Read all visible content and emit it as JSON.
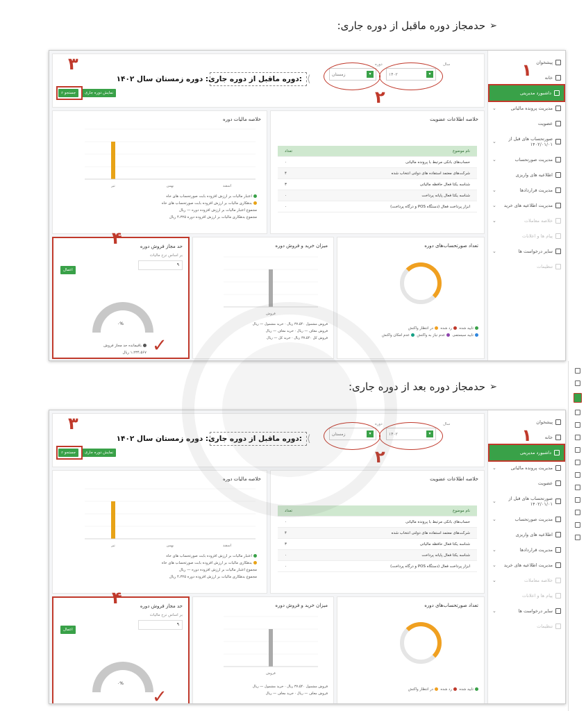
{
  "headings": {
    "prev_period": "حدمجاز دوره ماقبل از دوره جاری:",
    "next_period": "حدمجاز دوره بعد از دوره جاری:"
  },
  "sidebar": {
    "items": [
      {
        "label": "پیشخوان",
        "icon": "dashboard-icon"
      },
      {
        "label": "خانه",
        "icon": "home-icon"
      },
      {
        "label": "داشبورد مدیریتی",
        "icon": "chart-icon",
        "active": true
      },
      {
        "label": "مدیریت پرونده مالیاتی",
        "icon": "file-icon"
      },
      {
        "label": "عضویت",
        "icon": "user-icon"
      },
      {
        "label": "صورتحساب های قبل از ۱۴۰۲/۰۱/۰۱",
        "icon": "invoice-icon"
      },
      {
        "label": "مدیریت صورتحساب",
        "icon": "invoice-icon"
      },
      {
        "label": "اطلاعیه های واریزی",
        "icon": "notice-icon"
      },
      {
        "label": "مدیریت قراردادها",
        "icon": "contract-icon"
      },
      {
        "label": "مدیریت اطلاعیه های خرید",
        "icon": "cart-icon"
      },
      {
        "label": "خلاصه معاملات",
        "icon": "summary-icon",
        "dim": true
      },
      {
        "label": "پیام ها و اعلانات",
        "icon": "mail-icon",
        "dim": true
      },
      {
        "label": "سایر درخواست ها",
        "icon": "request-icon"
      },
      {
        "label": "تنظیمات",
        "icon": "gear-icon",
        "dim": true
      }
    ]
  },
  "filter": {
    "year_label": "سال",
    "year_value": "۱۴۰۲",
    "period_label": "دوره",
    "period_value": "زمستان",
    "callout": ":دوره ماقبل از دوره جاری: دوره زمستان سال ۱۴۰۲",
    "show_current_btn": "نمایش دوره جاری",
    "search_btn": "جستجو"
  },
  "marks": {
    "n1": "۱",
    "n2": "۲",
    "n3": "۳",
    "n4": "۴"
  },
  "membership": {
    "title": "خلاصه اطلاعات عضویت",
    "col_subject": "نام موضوع",
    "col_count": "تعداد",
    "rows": [
      {
        "subject": "حساب‌های بانکی مرتبط با پرونده مالیاتی",
        "count": "۰"
      },
      {
        "subject": "شرکت‌های معتمد استفاده های دولتی انتخاب شده",
        "count": "۴"
      },
      {
        "subject": "شناسه یکتا فعال حافظه مالیاتی",
        "count": "۳"
      },
      {
        "subject": "شناسه یکتا فعال پایانه پرداخت",
        "count": "۰"
      },
      {
        "subject": "ابزار پرداخت فعال (دستگاه POS و درگاه پرداخت)",
        "count": "۰"
      }
    ]
  },
  "tax_summary": {
    "title": "خلاصه مالیات دوره",
    "ylabel": "(میلیون ریال)",
    "legend": [
      "اعتبار مالیات بر ارزش افزوده بابت صورتحساب های خاه",
      "بدهکاری مالیات بر ارزش افزوده بابت صورتحساب های خاه",
      "مجموع اعتبار مالیات بر ارزش افزوده دوره — ریال",
      "مجموع بدهکاری مالیات بر ارزش افزوده دوره ۴،۳۲۵ ریال"
    ]
  },
  "chart_data": [
    {
      "type": "bar",
      "categories": [
        "تیر",
        "بهمن",
        "اسفند"
      ],
      "values": [
        1.2,
        0,
        0
      ],
      "ylim": [
        0,
        1.6
      ],
      "colors": [
        "#e8a317"
      ]
    },
    {
      "type": "bar",
      "categories": [
        "فروش"
      ],
      "values": [
        1.2
      ],
      "ylim": [
        0,
        1.6
      ],
      "colors": [
        "#aaaaaa"
      ]
    }
  ],
  "sales_limit": {
    "title": "حد مجاز فروش دوره",
    "subtitle": "بر اساس نرخ مالیات",
    "input_value": "۹",
    "apply_btn": "اعمال",
    "gauge_value": "۰%",
    "legend_name": "باقیمانده حد مجاز فروش",
    "legend_value": "۱،۲۳۴،۵۶۷ ریال"
  },
  "trade": {
    "title": "میزان خرید و فروش دوره",
    "ylabel": "(میلیون ریال)",
    "xlabel": "فروش",
    "legend": [
      "فروش مشمول ۳۷،۵۴۰ ریال",
      "خرید مشمول — ریال",
      "فروش معاف — ریال",
      "خرید معاف — ریال",
      "فروش کل ۳۷،۵۴۰ ریال",
      "خرید کل — ریال"
    ]
  },
  "invoice_count": {
    "title": "تعداد صورتحساب‌های دوره",
    "donut_label": "تعداد صورتحساب فروش",
    "donut_value": "۲۵",
    "legend": [
      "تایید شده",
      "رد شده",
      "در انتظار واکنش",
      "تایید سیستمی",
      "عدم نیاز به واکنش",
      "عدم امکان واکنش"
    ]
  },
  "colors": {
    "brand_green": "#39a148",
    "annotation_red": "#c0392b",
    "bar_orange": "#e8a317"
  }
}
